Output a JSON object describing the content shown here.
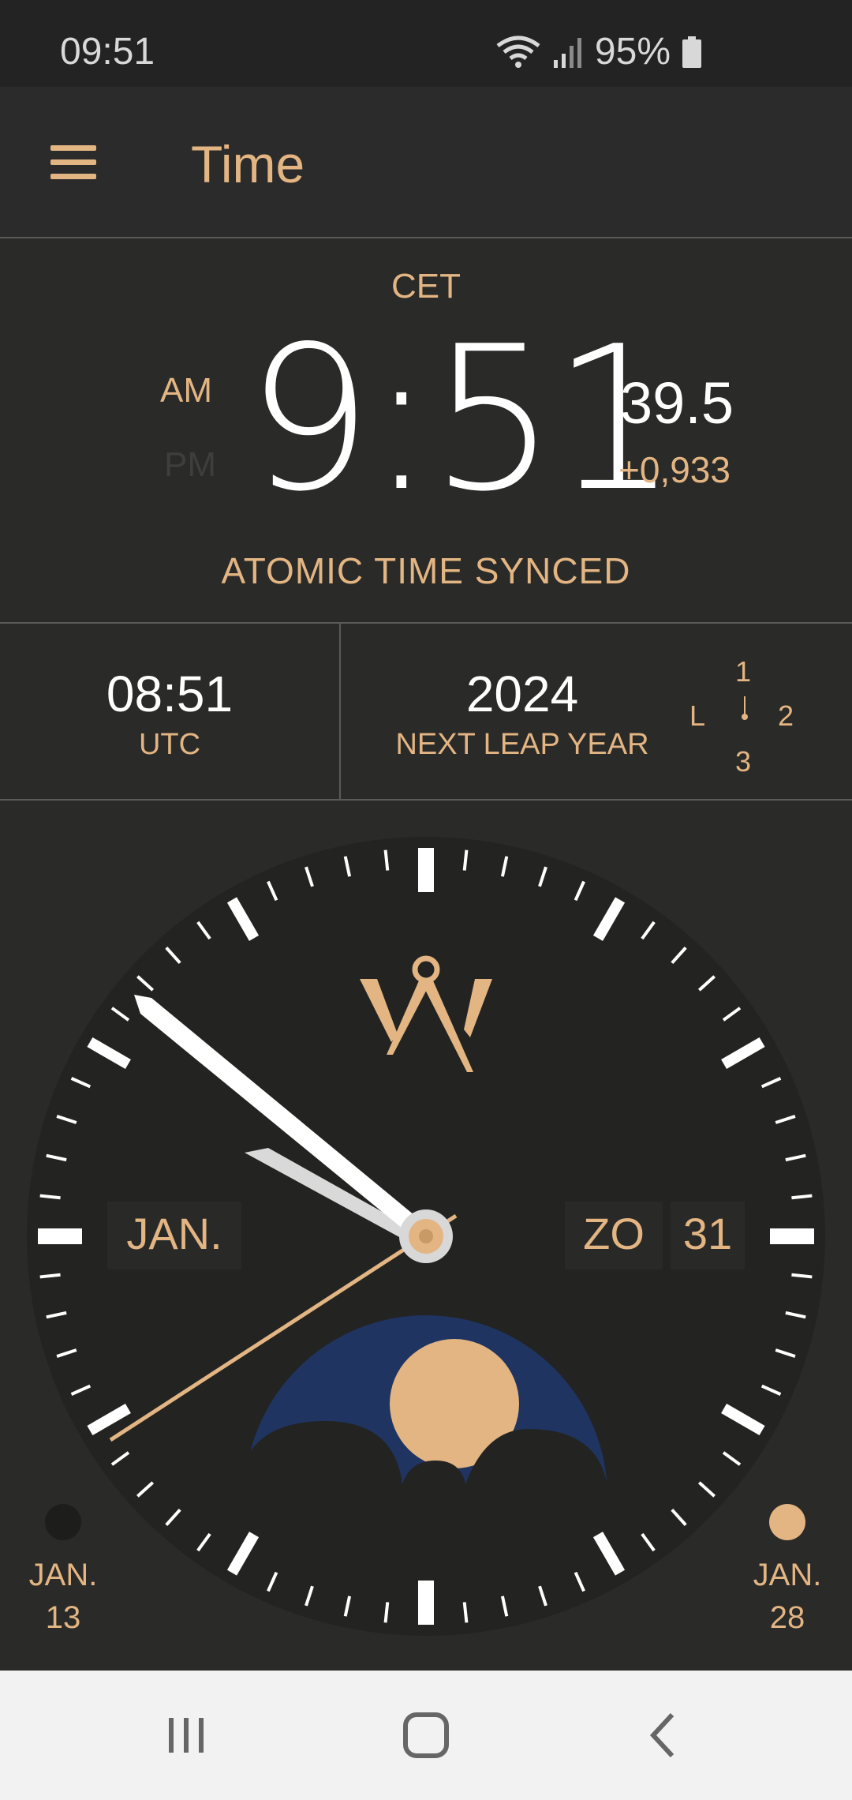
{
  "status_bar": {
    "time": "09:51",
    "battery": "95%"
  },
  "app_bar": {
    "title": "Time"
  },
  "time_panel": {
    "timezone": "CET",
    "am": "AM",
    "pm": "PM",
    "time": "9:51",
    "seconds": "39.5",
    "offset": "+0,933",
    "sync_status": "ATOMIC TIME SYNCED"
  },
  "info": {
    "utc_time": "08:51",
    "utc_label": "UTC",
    "leap_year": "2024",
    "leap_label": "NEXT LEAP YEAR",
    "leap_indicator": {
      "top": "1",
      "right": "2",
      "bottom": "3",
      "left": "L"
    }
  },
  "dial": {
    "month": "JAN.",
    "weekday": "ZO",
    "day": "31",
    "new_moon": {
      "month": "JAN.",
      "day": "13"
    },
    "full_moon": {
      "month": "JAN.",
      "day": "28"
    }
  },
  "colors": {
    "accent": "#e3b582",
    "background": "#2a2a29",
    "moon_sky": "#1f3461"
  }
}
